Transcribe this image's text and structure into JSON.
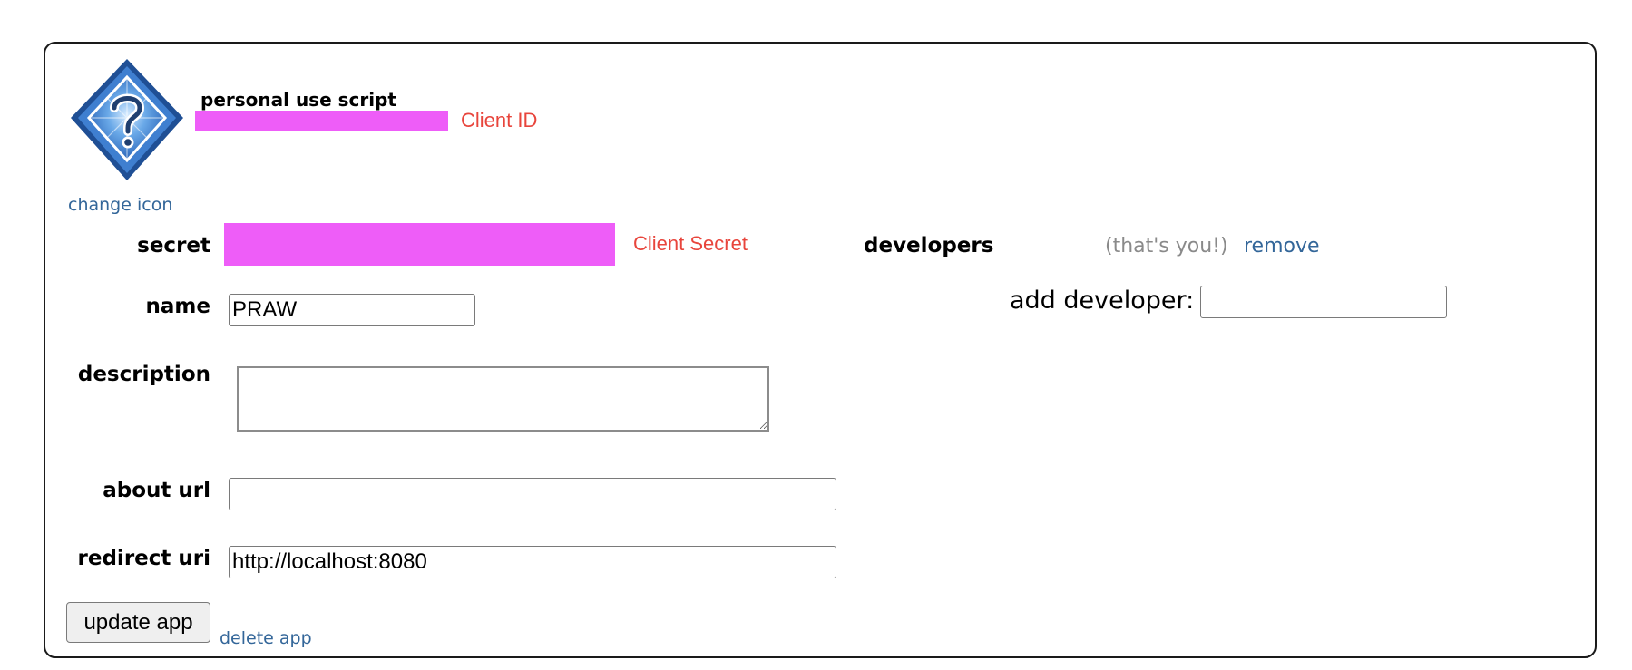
{
  "app": {
    "type_label": "personal use script",
    "client_id_annotation": "Client ID",
    "client_secret_annotation": "Client Secret",
    "change_icon_link": "change icon",
    "icon": "question-mark-diamond-icon"
  },
  "form": {
    "secret_label": "secret",
    "name_label": "name",
    "name_value": "PRAW",
    "description_label": "description",
    "description_value": "",
    "about_url_label": "about url",
    "about_url_value": "",
    "redirect_uri_label": "redirect uri",
    "redirect_uri_value": "http://localhost:8080",
    "update_button": "update app",
    "delete_link": "delete app"
  },
  "developers": {
    "label": "developers",
    "note": "(that's you!)",
    "remove_link": "remove",
    "add_label": "add developer:",
    "add_value": ""
  },
  "colors": {
    "redaction": "#ee5df8",
    "annotation": "#e8453c",
    "link": "#336699",
    "border": "#1a1a1a"
  }
}
